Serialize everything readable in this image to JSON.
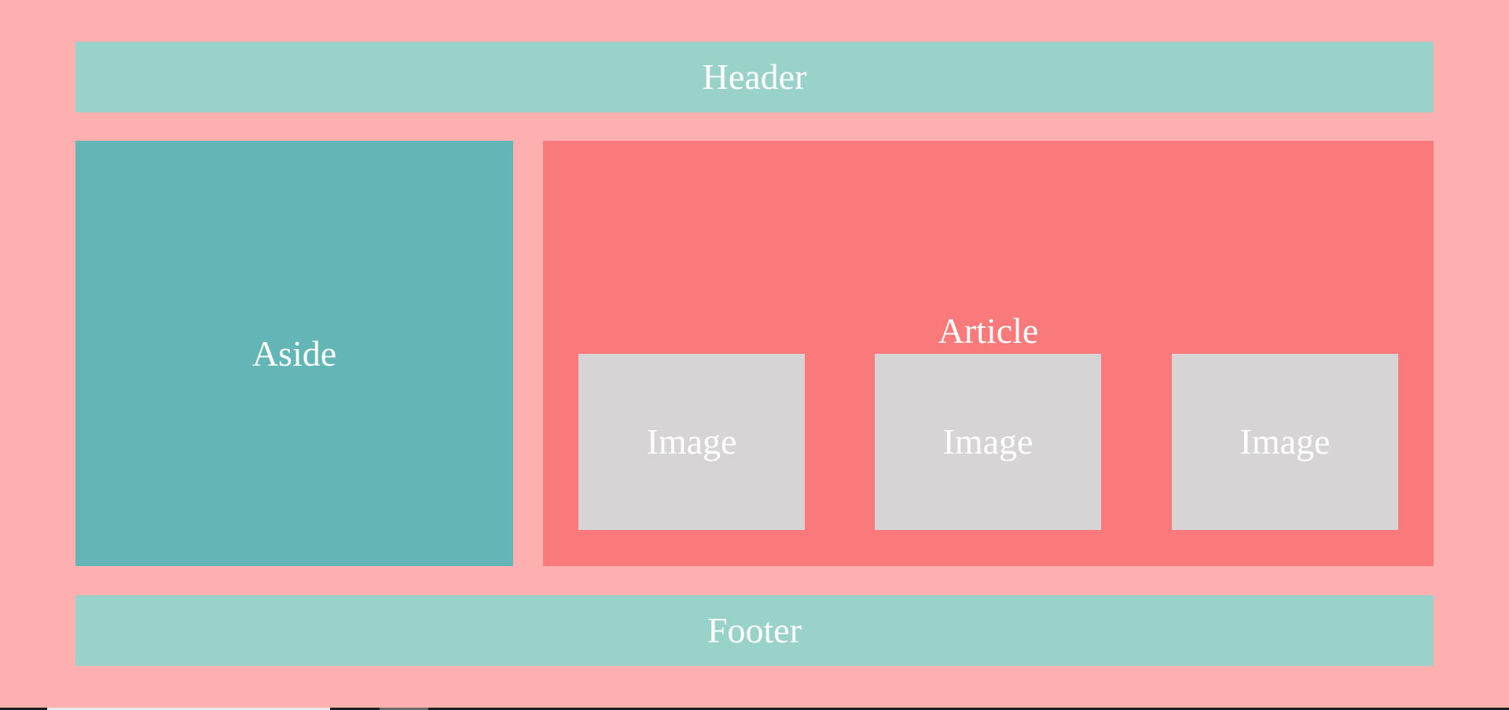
{
  "colors": {
    "page_background": "#feafaf",
    "header_background": "#98d2c8",
    "aside_background": "#64b5b6",
    "article_background": "#fa7a7b",
    "image_background": "#d6d4d5",
    "footer_background": "#98d2c8",
    "text": "#ffffff"
  },
  "header": {
    "label": "Header"
  },
  "aside": {
    "label": "Aside"
  },
  "article": {
    "label": "Article",
    "images": [
      {
        "label": "Image"
      },
      {
        "label": "Image"
      },
      {
        "label": "Image"
      }
    ]
  },
  "footer": {
    "label": "Footer"
  }
}
